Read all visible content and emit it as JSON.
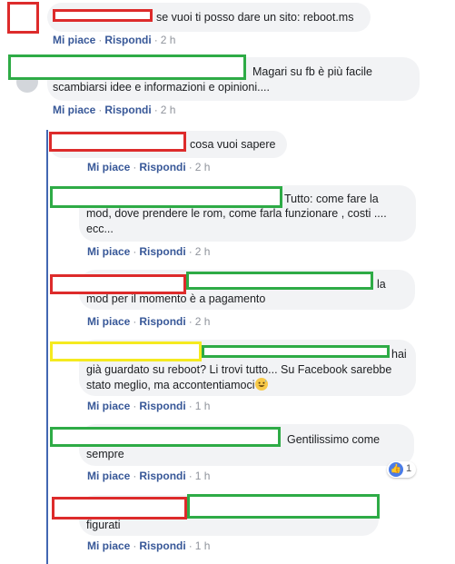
{
  "actions": {
    "like": "Mi piace",
    "reply": "Rispondi",
    "sep": "·"
  },
  "comments": [
    {
      "text_lines": [
        "se vuoi ti posso dare un sito: reboot.ms"
      ],
      "time": "2 h"
    },
    {
      "text_lines": [
        "Magari su fb è più facile",
        "scambiarsi idee e informazioni e opinioni...."
      ],
      "time": "2 h"
    },
    {
      "text_lines": [
        "cosa vuoi sapere"
      ],
      "time": "2 h"
    },
    {
      "text_lines": [
        "Tutto: come fare la",
        "mod, dove prendere le rom, come farla funzionare , costi ....",
        "ecc..."
      ],
      "time": "2 h"
    },
    {
      "text_lines": [
        "la",
        "mod per il momento è a pagamento"
      ],
      "time": "2 h"
    },
    {
      "text_lines": [
        "hai",
        "già guardato su reboot? Li trovi tutto... Su Facebook sarebbe",
        "stato meglio, ma accontentiamoci"
      ],
      "time": "1 h"
    },
    {
      "text_lines": [
        "Gentilissimo come",
        "sempre"
      ],
      "time": "1 h",
      "reaction": {
        "icon": "like-icon",
        "count": "1"
      }
    },
    {
      "text_lines": [
        "figurati"
      ],
      "time": "1 h"
    }
  ],
  "colors": {
    "thread_line": "#4267b2",
    "link": "#385898",
    "redaction_red": "#dd2b2b",
    "redaction_green": "#2eab46",
    "redaction_yellow": "#f5ea1f"
  }
}
